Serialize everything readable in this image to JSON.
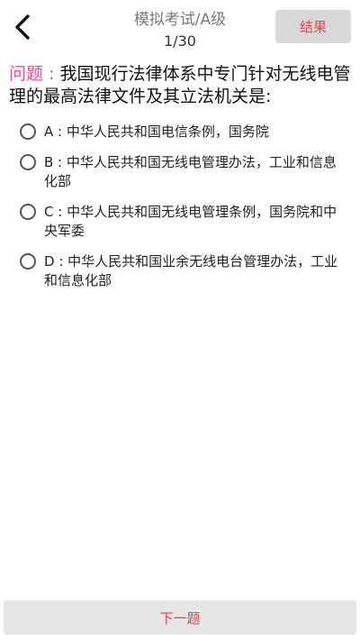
{
  "header": {
    "title": "模拟考试/A级",
    "counter": "1/30",
    "result_label": "结果"
  },
  "question": {
    "label": "问题 : ",
    "text": "我国现行法律体系中专门针对无线电管理的最高法律文件及其立法机关是:"
  },
  "options": [
    {
      "text": "A : 中华人民共和国电信条例，国务院"
    },
    {
      "text": "B : 中华人民共和国无线电管理办法，工业和信息化部"
    },
    {
      "text": "C : 中华人民共和国无线电管理条例，国务院和中央军委"
    },
    {
      "text": "D : 中华人民共和国业余无线电台管理办法，工业和信息化部"
    }
  ],
  "footer": {
    "next_label": "下一题"
  },
  "icons": {
    "back": "chevron-left-icon",
    "option": "radio-icon"
  }
}
